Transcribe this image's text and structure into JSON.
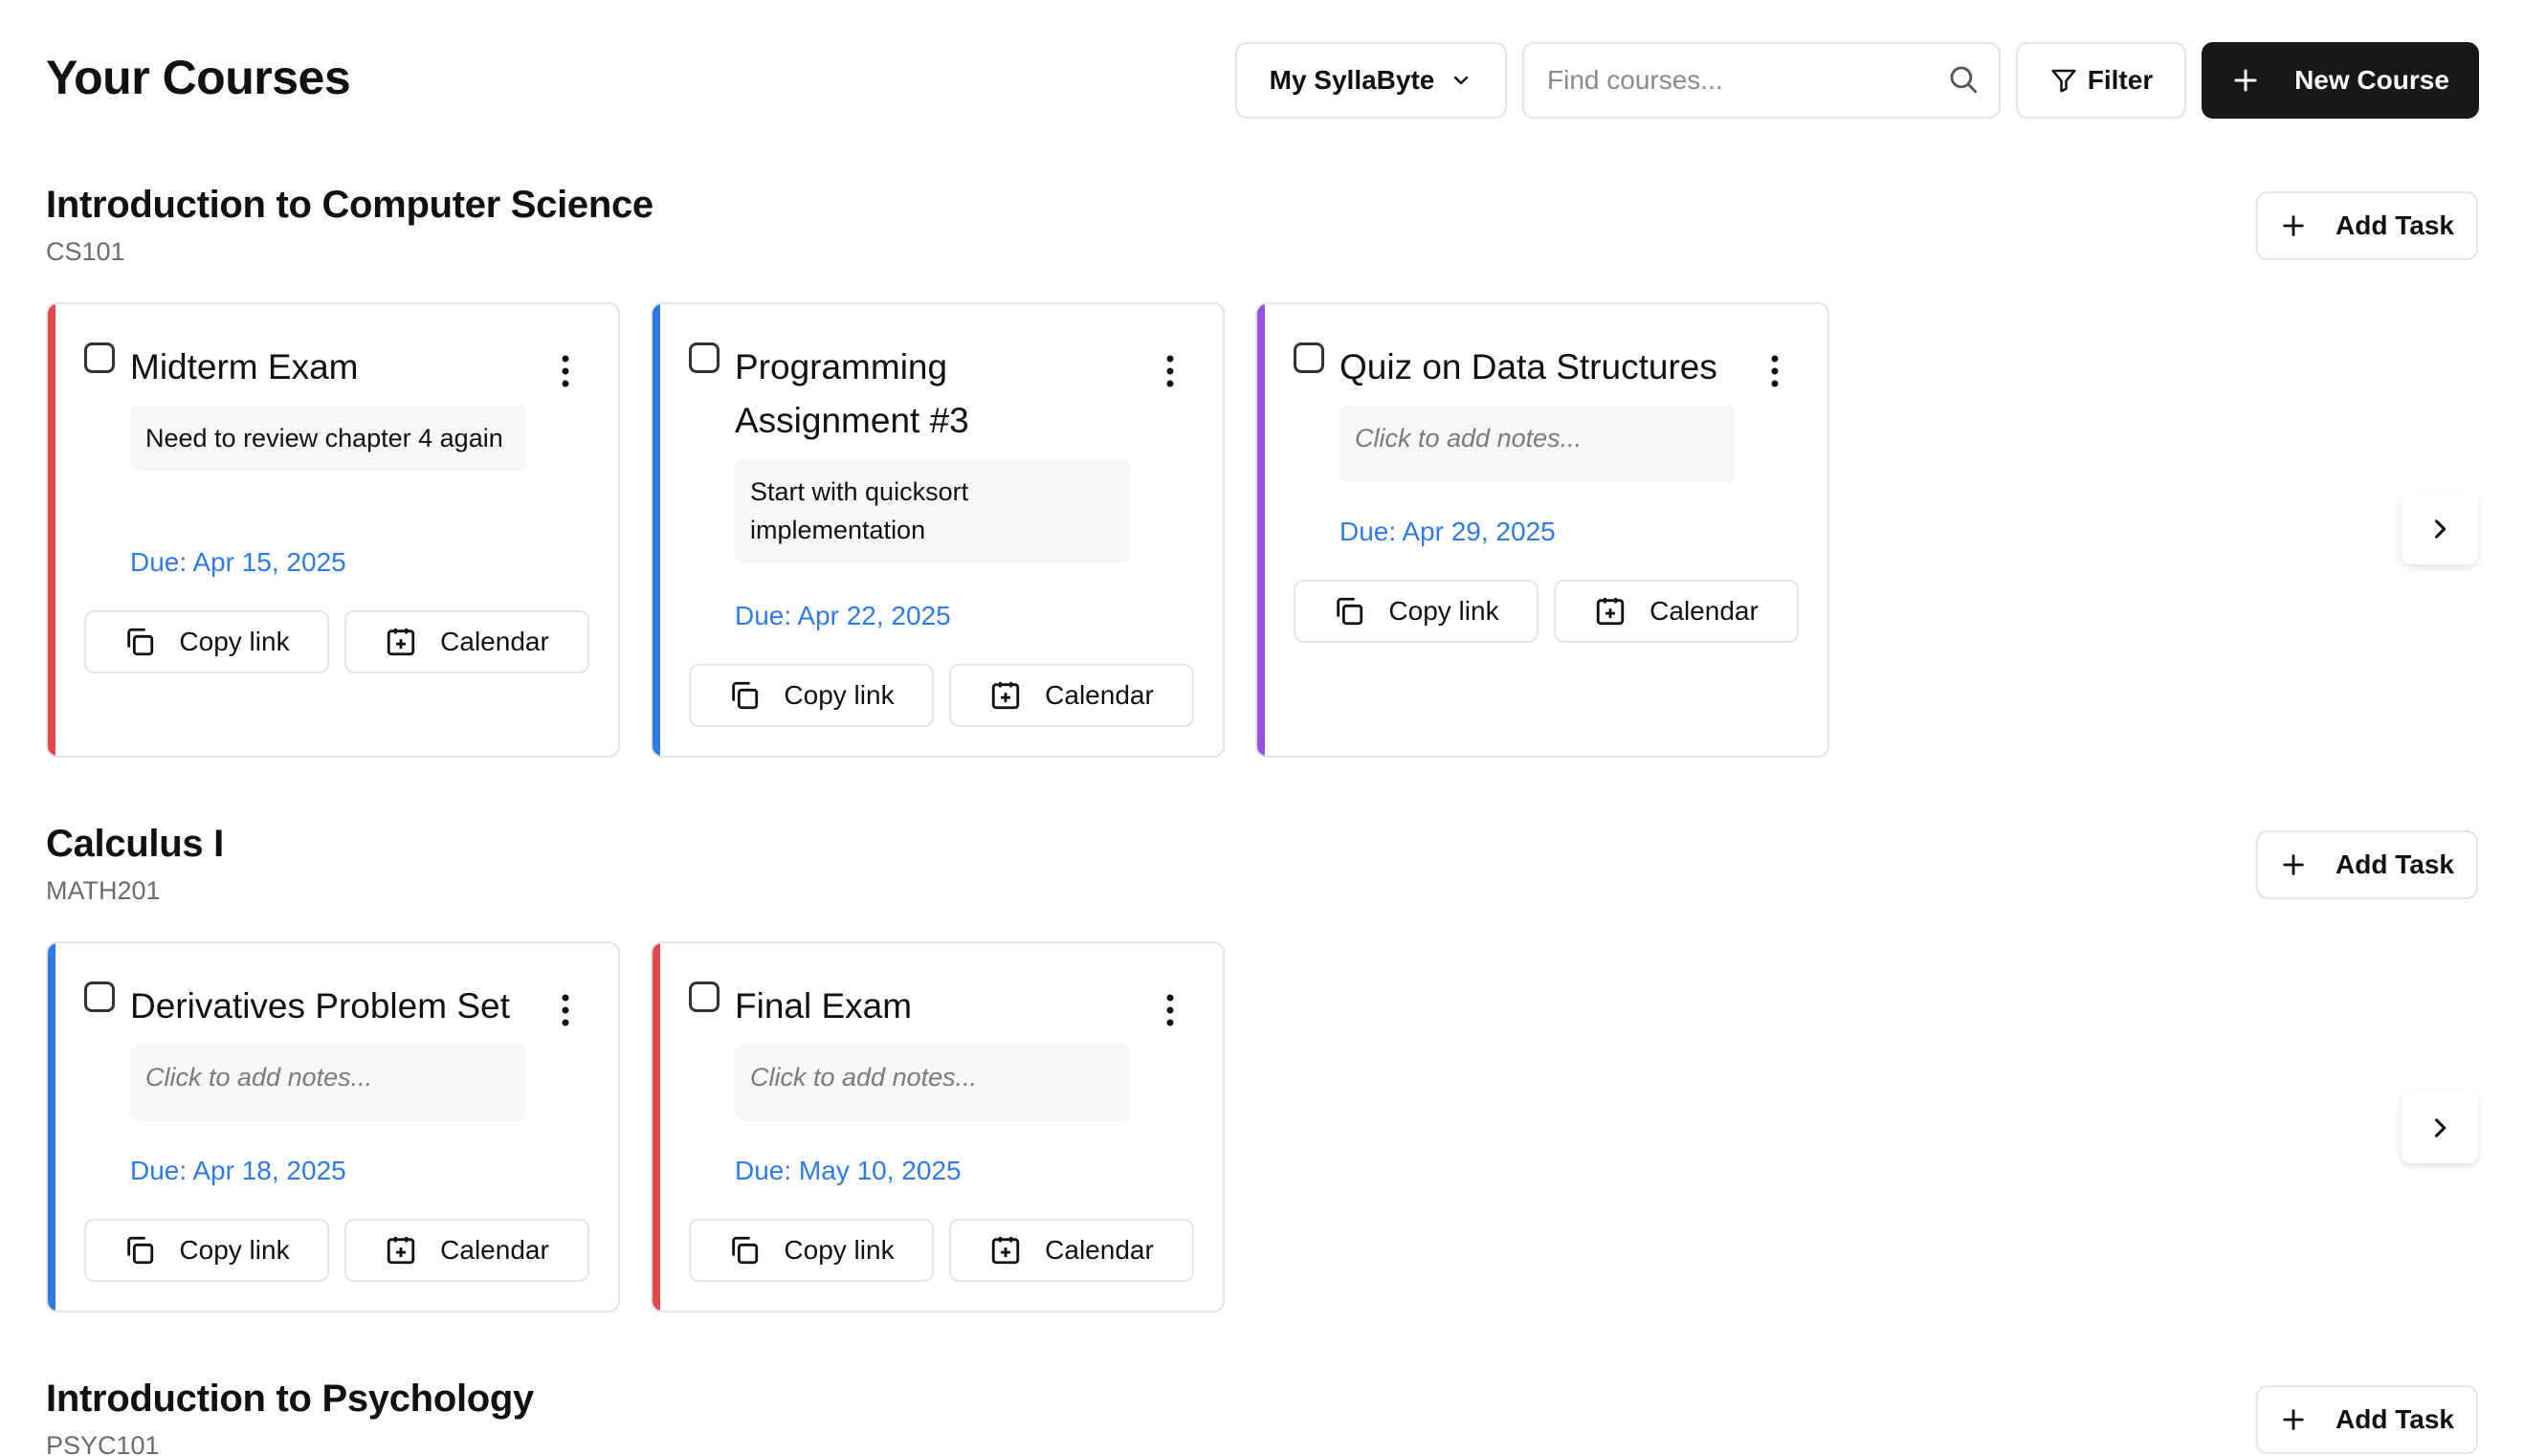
{
  "header": {
    "title": "Your Courses",
    "workspace_label": "My SyllaByte",
    "search_placeholder": "Find courses...",
    "filter_label": "Filter",
    "new_course_label": "New Course"
  },
  "colors": {
    "red": "#e5484d",
    "blue": "#2f7be6",
    "purple": "#9b51e0",
    "primary_button": "#18181b",
    "due_text": "#2f7be6"
  },
  "courses": [
    {
      "title": "Introduction to Computer Science",
      "code": "CS101",
      "add_task_label": "Add Task",
      "tasks": [
        {
          "title": "Midterm Exam",
          "notes": "Need to review chapter 4 again",
          "due": "Due: Apr 15, 2025",
          "copy_label": "Copy link",
          "calendar_label": "Calendar",
          "accent": "#e5484d"
        },
        {
          "title": "Programming Assignment #3",
          "notes": "Start with quicksort implementation",
          "due": "Due: Apr 22, 2025",
          "copy_label": "Copy link",
          "calendar_label": "Calendar",
          "accent": "#2f7be6"
        },
        {
          "title": "Quiz on Data Structures",
          "notes": "Click to add notes...",
          "due": "Due: Apr 29, 2025",
          "copy_label": "Copy link",
          "calendar_label": "Calendar",
          "accent": "#9b51e0"
        }
      ]
    },
    {
      "title": "Calculus I",
      "code": "MATH201",
      "add_task_label": "Add Task",
      "tasks": [
        {
          "title": "Derivatives Problem Set",
          "notes": "Click to add notes...",
          "due": "Due: Apr 18, 2025",
          "copy_label": "Copy link",
          "calendar_label": "Calendar",
          "accent": "#2f7be6"
        },
        {
          "title": "Final Exam",
          "notes": "Click to add notes...",
          "due": "Due: May 10, 2025",
          "copy_label": "Copy link",
          "calendar_label": "Calendar",
          "accent": "#e5484d"
        }
      ]
    },
    {
      "title": "Introduction to Psychology",
      "code": "PSYC101",
      "add_task_label": "Add Task",
      "tasks": []
    }
  ]
}
